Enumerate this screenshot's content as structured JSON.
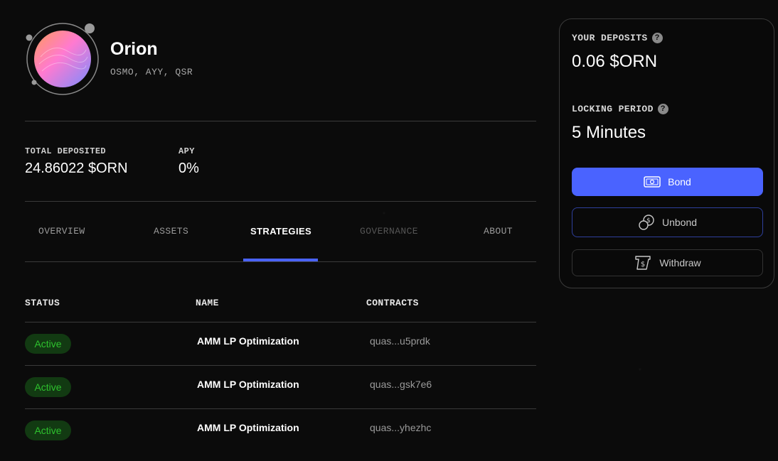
{
  "vault": {
    "name": "Orion",
    "assets": "OSMO, AYY, QSR"
  },
  "stats": {
    "total_deposited_label": "TOTAL DEPOSITED",
    "total_deposited_value": "24.86022 $ORN",
    "apy_label": "APY",
    "apy_value": "0%"
  },
  "tabs": [
    {
      "label": "OVERVIEW",
      "state": "normal"
    },
    {
      "label": "ASSETS",
      "state": "normal"
    },
    {
      "label": "STRATEGIES",
      "state": "active"
    },
    {
      "label": "GOVERNANCE",
      "state": "disabled"
    },
    {
      "label": "ABOUT",
      "state": "normal"
    }
  ],
  "table": {
    "headers": [
      "STATUS",
      "NAME",
      "CONTRACTS"
    ],
    "rows": [
      {
        "status": "Active",
        "name": "AMM LP Optimization",
        "contract": "quas...u5prdk"
      },
      {
        "status": "Active",
        "name": "AMM LP Optimization",
        "contract": "quas...gsk7e6"
      },
      {
        "status": "Active",
        "name": "AMM LP Optimization",
        "contract": "quas...yhezhc"
      }
    ]
  },
  "panel": {
    "deposits_label": "YOUR DEPOSITS",
    "deposits_value": "0.06 $ORN",
    "locking_label": "LOCKING PERIOD",
    "locking_value": "5 Minutes",
    "help_glyph": "?",
    "bond_label": "Bond",
    "unbond_label": "Unbond",
    "withdraw_label": "Withdraw"
  },
  "colors": {
    "accent": "#4a63ff",
    "status_active_text": "#2ec22e",
    "status_active_bg": "#123a12",
    "background": "#0b0b0b"
  },
  "icons": [
    "vault-orbit-logo",
    "help-icon",
    "cash-icon",
    "coins-dollar-icon",
    "withdraw-ticket-icon"
  ]
}
